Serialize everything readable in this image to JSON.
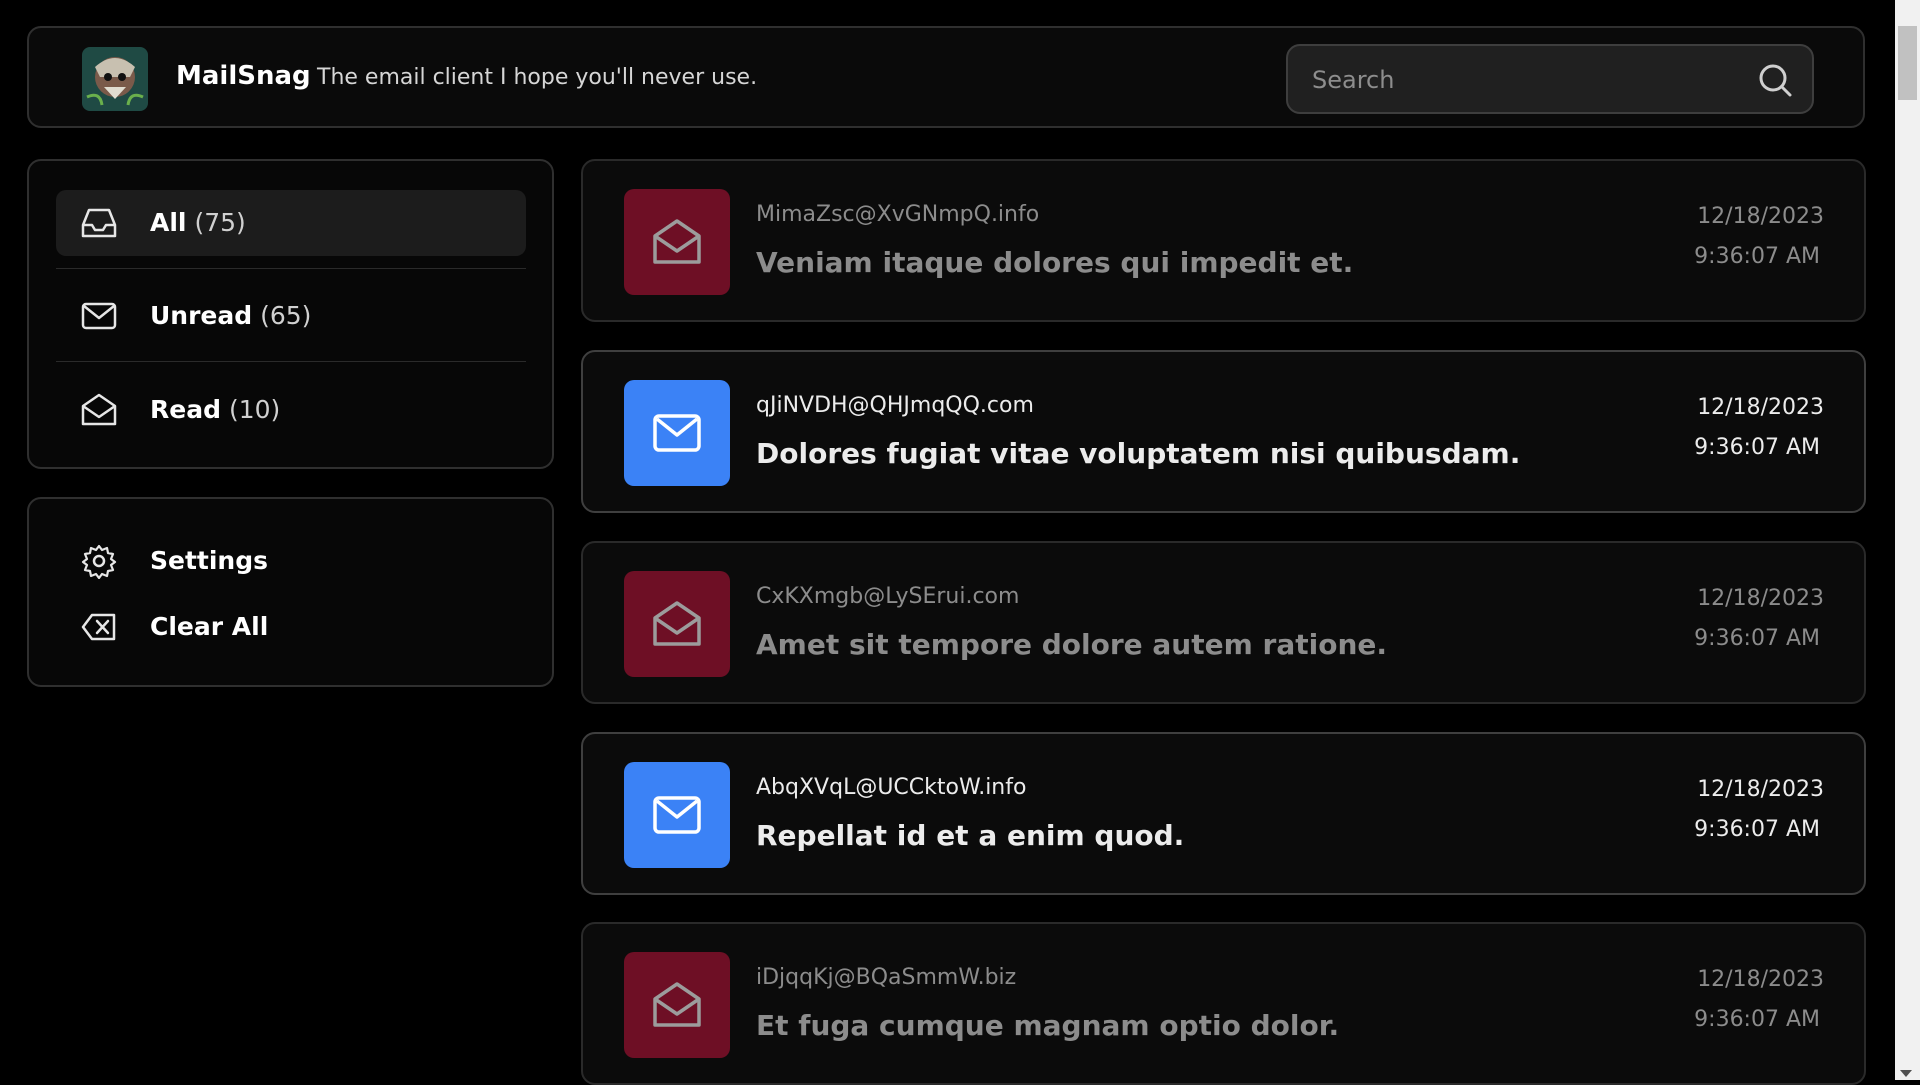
{
  "header": {
    "app_name": "MailSnag",
    "tagline": "The email client I hope you'll never use.",
    "search_placeholder": "Search",
    "search_value": ""
  },
  "folders": [
    {
      "label": "All",
      "count": "(75)",
      "icon": "inbox-icon",
      "active": true
    },
    {
      "label": "Unread",
      "count": "(65)",
      "icon": "mail-closed-icon",
      "active": false
    },
    {
      "label": "Read",
      "count": "(10)",
      "icon": "mail-open-icon",
      "active": false
    }
  ],
  "actions": [
    {
      "label": "Settings",
      "icon": "gear-icon"
    },
    {
      "label": "Clear All",
      "icon": "backspace-icon"
    }
  ],
  "emails": [
    {
      "from": "MimaZsc@XvGNmpQ.info",
      "subject": "Veniam itaque dolores qui impedit et.",
      "date": "12/18/2023",
      "time": "9:36:07 AM",
      "status": "read"
    },
    {
      "from": "qJiNVDH@QHJmqQQ.com",
      "subject": "Dolores fugiat vitae voluptatem nisi quibusdam.",
      "date": "12/18/2023",
      "time": "9:36:07 AM",
      "status": "unread"
    },
    {
      "from": "CxKXmgb@LySErui.com",
      "subject": "Amet sit tempore dolore autem ratione.",
      "date": "12/18/2023",
      "time": "9:36:07 AM",
      "status": "read"
    },
    {
      "from": "AbqXVqL@UCCktoW.info",
      "subject": "Repellat id et a enim quod.",
      "date": "12/18/2023",
      "time": "9:36:07 AM",
      "status": "unread"
    },
    {
      "from": "iDjqqKj@BQaSmmW.biz",
      "subject": "Et fuga cumque magnam optio dolor.",
      "date": "12/18/2023",
      "time": "9:36:07 AM",
      "status": "read"
    }
  ],
  "colors": {
    "read_badge": "#6e0f25",
    "unread_badge": "#3b82f6",
    "background": "#000000"
  }
}
